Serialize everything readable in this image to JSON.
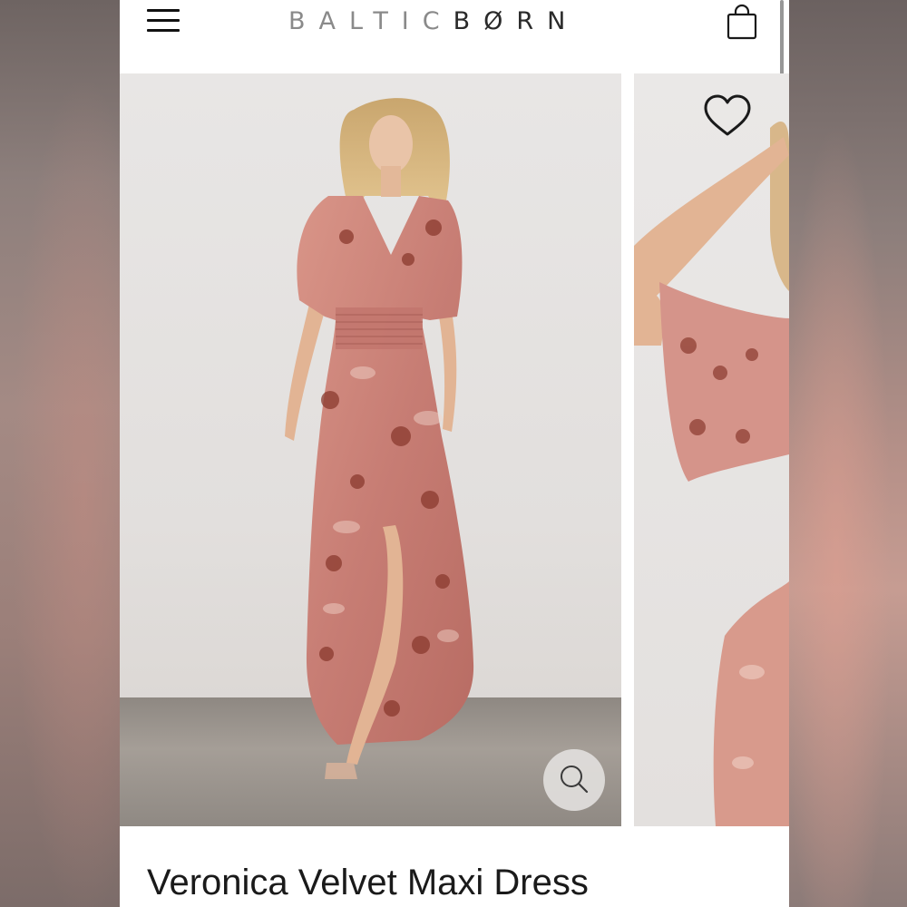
{
  "header": {
    "logo_light": "BALTIC",
    "logo_dark": "BØRN"
  },
  "icons": {
    "menu": "hamburger-menu-icon",
    "bag": "shopping-bag-icon",
    "wishlist": "heart-icon",
    "zoom": "magnifier-icon"
  },
  "product": {
    "title": "Veronica Velvet Maxi Dress"
  },
  "colors": {
    "dress": "#c47b74",
    "floral": "#8a3a2e",
    "background": "#ffffff"
  }
}
